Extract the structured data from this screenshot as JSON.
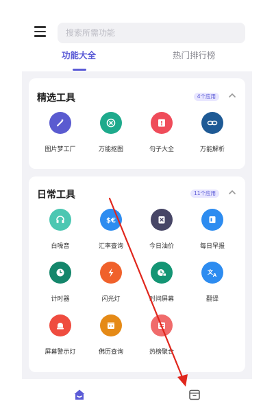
{
  "search": {
    "placeholder": "搜索所需功能"
  },
  "tabs": [
    {
      "label": "功能大全",
      "active": true
    },
    {
      "label": "热门排行榜",
      "active": false
    }
  ],
  "sections": [
    {
      "title": "精选工具",
      "badge": "4个应用",
      "tools": [
        {
          "label": "图片梦工厂",
          "icon": "magic-wand-icon",
          "color": "#5a5bd0"
        },
        {
          "label": "万能抠图",
          "icon": "cutout-icon",
          "color": "#1eaa8c"
        },
        {
          "label": "句子大全",
          "icon": "quote-book-icon",
          "color": "#ef4c5a"
        },
        {
          "label": "万能解析",
          "icon": "link-icon",
          "color": "#1e5a95"
        }
      ]
    },
    {
      "title": "日常工具",
      "badge": "11个应用",
      "tools": [
        {
          "label": "白噪音",
          "icon": "noise-icon",
          "color": "#4cc7b2"
        },
        {
          "label": "汇率查询",
          "icon": "currency-icon",
          "color": "#2d8cf0"
        },
        {
          "label": "今日油价",
          "icon": "oil-price-icon",
          "color": "#474666"
        },
        {
          "label": "每日早报",
          "icon": "news-icon",
          "color": "#2d8cf0"
        },
        {
          "label": "计时器",
          "icon": "timer-icon",
          "color": "#14866b"
        },
        {
          "label": "闪光灯",
          "icon": "flash-icon",
          "color": "#f0612b"
        },
        {
          "label": "时间屏幕",
          "icon": "time-screen-icon",
          "color": "#149574"
        },
        {
          "label": "翻译",
          "icon": "translate-icon",
          "color": "#2d8cf0"
        },
        {
          "label": "屏幕警示灯",
          "icon": "alarm-light-icon",
          "color": "#ef4c3f"
        },
        {
          "label": "佛历查询",
          "icon": "calendar-icon",
          "color": "#e58a16"
        },
        {
          "label": "热榜聚合",
          "icon": "hot-list-icon",
          "color": "#f06b6b"
        }
      ]
    }
  ],
  "bottom_nav": [
    {
      "icon": "home-icon",
      "color": "#5b5bd6",
      "active": true
    },
    {
      "icon": "archive-box-icon",
      "color": "#555555",
      "active": false
    }
  ],
  "colors": {
    "accent": "#5b5bd6",
    "annotation_arrow": "#e0261c"
  }
}
